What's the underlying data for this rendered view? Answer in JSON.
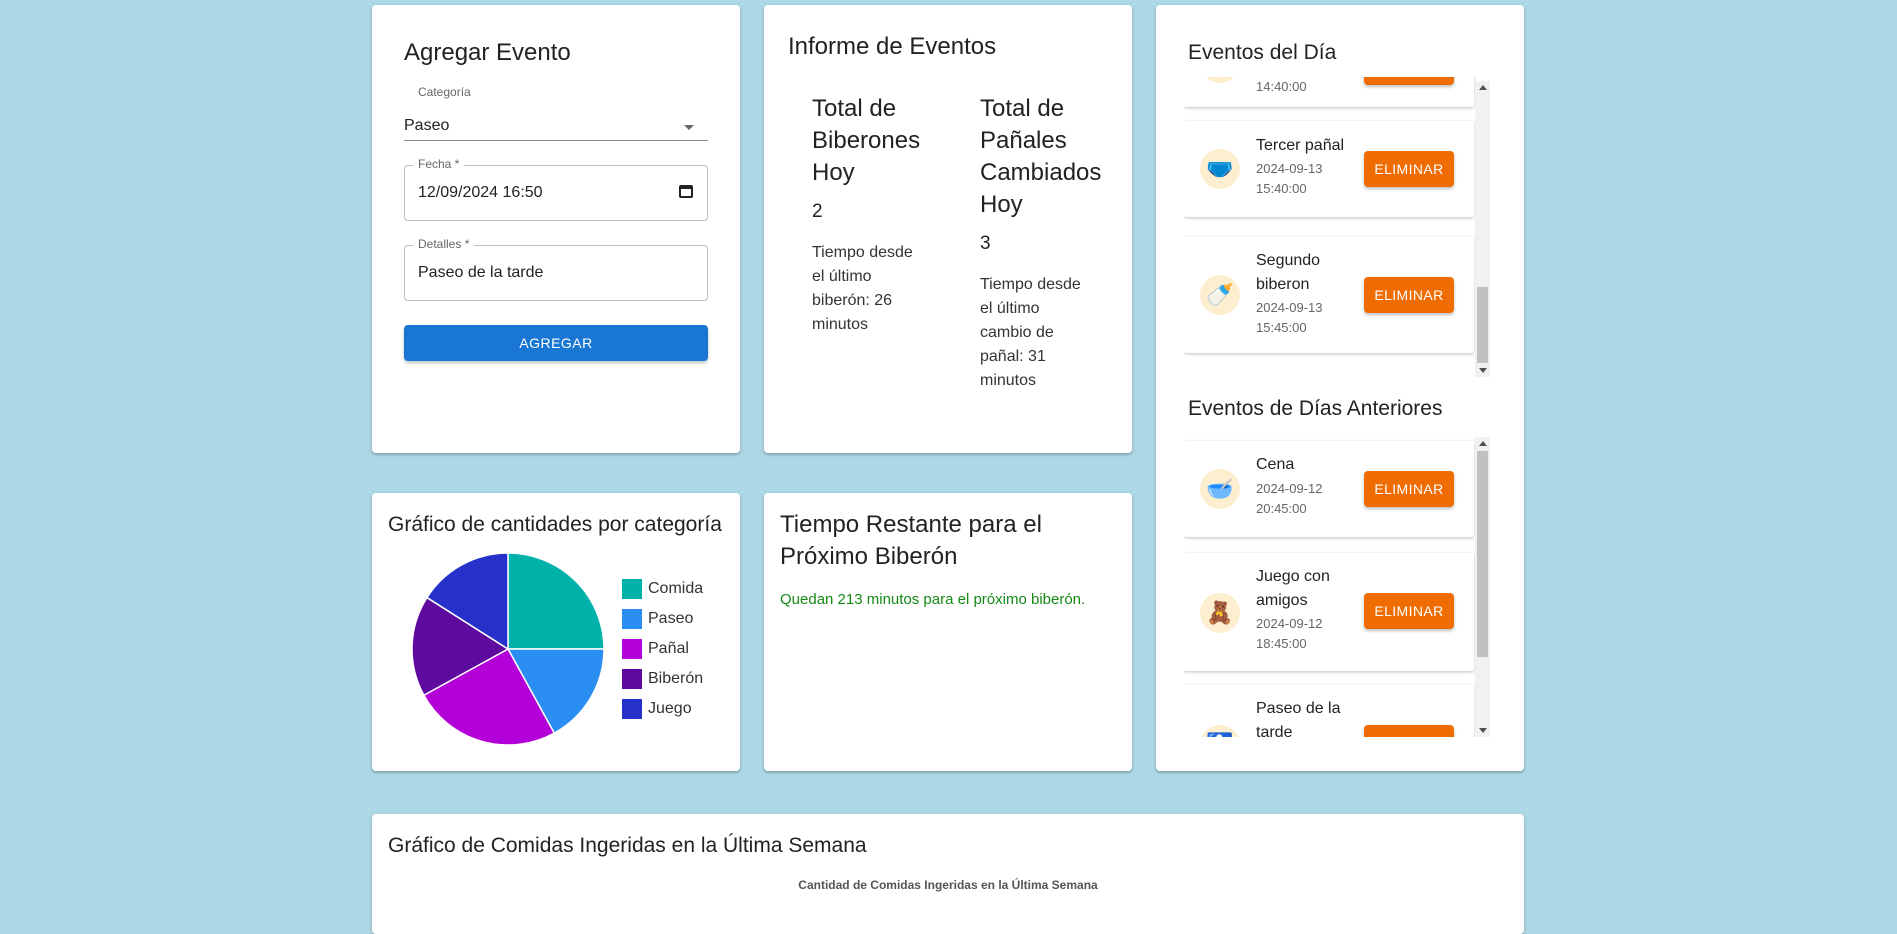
{
  "add_event": {
    "title": "Agregar Evento",
    "category_label": "Categoría",
    "category_value": "Paseo",
    "date_label": "Fecha *",
    "date_value": "12/09/2024  16:50",
    "details_label": "Detalles *",
    "details_value": "Paseo de la tarde",
    "submit_label": "AGREGAR"
  },
  "report": {
    "title": "Informe de Eventos",
    "bottles_heading": "Total de Biberones Hoy",
    "bottles_count": "2",
    "bottles_since": "Tiempo desde el último biberón: 26 minutos",
    "diapers_heading": "Total de Pañales Cambiados Hoy",
    "diapers_count": "3",
    "diapers_since": "Tiempo desde el último cambio de pañal: 31 minutos"
  },
  "today_events": {
    "title": "Eventos del Día",
    "items": [
      {
        "name": "",
        "date": "14:40:00",
        "icon": "clock-icon"
      },
      {
        "name": "Tercer pañal",
        "date": "2024-09-13 15:40:00",
        "icon": "diaper-icon"
      },
      {
        "name": "Segundo biberon",
        "date": "2024-09-13 15:45:00",
        "icon": "bottle-icon"
      }
    ],
    "delete_label": "ELIMINAR"
  },
  "previous_events": {
    "title": "Eventos de Días Anteriores",
    "items": [
      {
        "name": "Cena",
        "date": "2024-09-12 20:45:00",
        "icon": "bib-icon"
      },
      {
        "name": "Juego con amigos",
        "date": "2024-09-12 18:45:00",
        "icon": "toy-icon"
      },
      {
        "name": "Paseo de la tarde",
        "date": "",
        "icon": "stroller-icon"
      }
    ],
    "delete_label": "ELIMINAR"
  },
  "pie_card": {
    "title": "Gráfico de cantidades por categoría"
  },
  "chart_data": {
    "type": "pie",
    "categories": [
      "Comida",
      "Paseo",
      "Pañal",
      "Biberón",
      "Juego"
    ],
    "values": [
      25,
      17,
      25,
      17,
      16
    ],
    "colors": [
      "#00b2a9",
      "#2b8ef2",
      "#b300d8",
      "#5f0a9e",
      "#2531c8"
    ],
    "legend": "right"
  },
  "remaining": {
    "title": "Tiempo Restante para el Próximo Biberón",
    "message": "Quedan 213 minutos para el próximo biberón."
  },
  "weekly": {
    "title": "Gráfico de Comidas Ingeridas en la Última Semana",
    "chart_title": "Cantidad de Comidas Ingeridas en la Última Semana"
  }
}
